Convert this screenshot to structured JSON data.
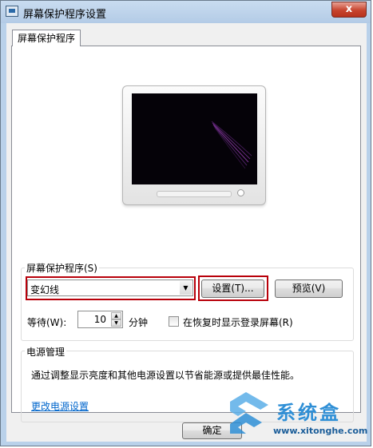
{
  "window": {
    "title": "屏幕保护程序设置",
    "close_symbol": "x",
    "icon": "screensaver-settings-icon"
  },
  "tabs": [
    {
      "label": "屏幕保护程序",
      "selected": true
    }
  ],
  "preview": {
    "description": "monitor-preview",
    "screen_color": "#050208",
    "ribbon_color": "#6a2d86"
  },
  "screensaver": {
    "group_label": "屏幕保护程序(S)",
    "selected": "变幻线",
    "settings_button": "设置(T)...",
    "preview_button": "预览(V)",
    "wait_label": "等待(W):",
    "wait_value": "10",
    "wait_unit": "分钟",
    "resume_label": "在恢复时显示登录屏幕(R)",
    "resume_checked": false
  },
  "power": {
    "group_label": "电源管理",
    "description": "通过调整显示亮度和其他电源设置以节省能源或提供最佳性能。",
    "link": "更改电源设置"
  },
  "footer": {
    "ok_button": "确定"
  },
  "watermark": {
    "brand": "系统盒",
    "url": "www.xitonghe.com",
    "color": "#2f8fd6"
  },
  "highlight_color": "#b8000a"
}
